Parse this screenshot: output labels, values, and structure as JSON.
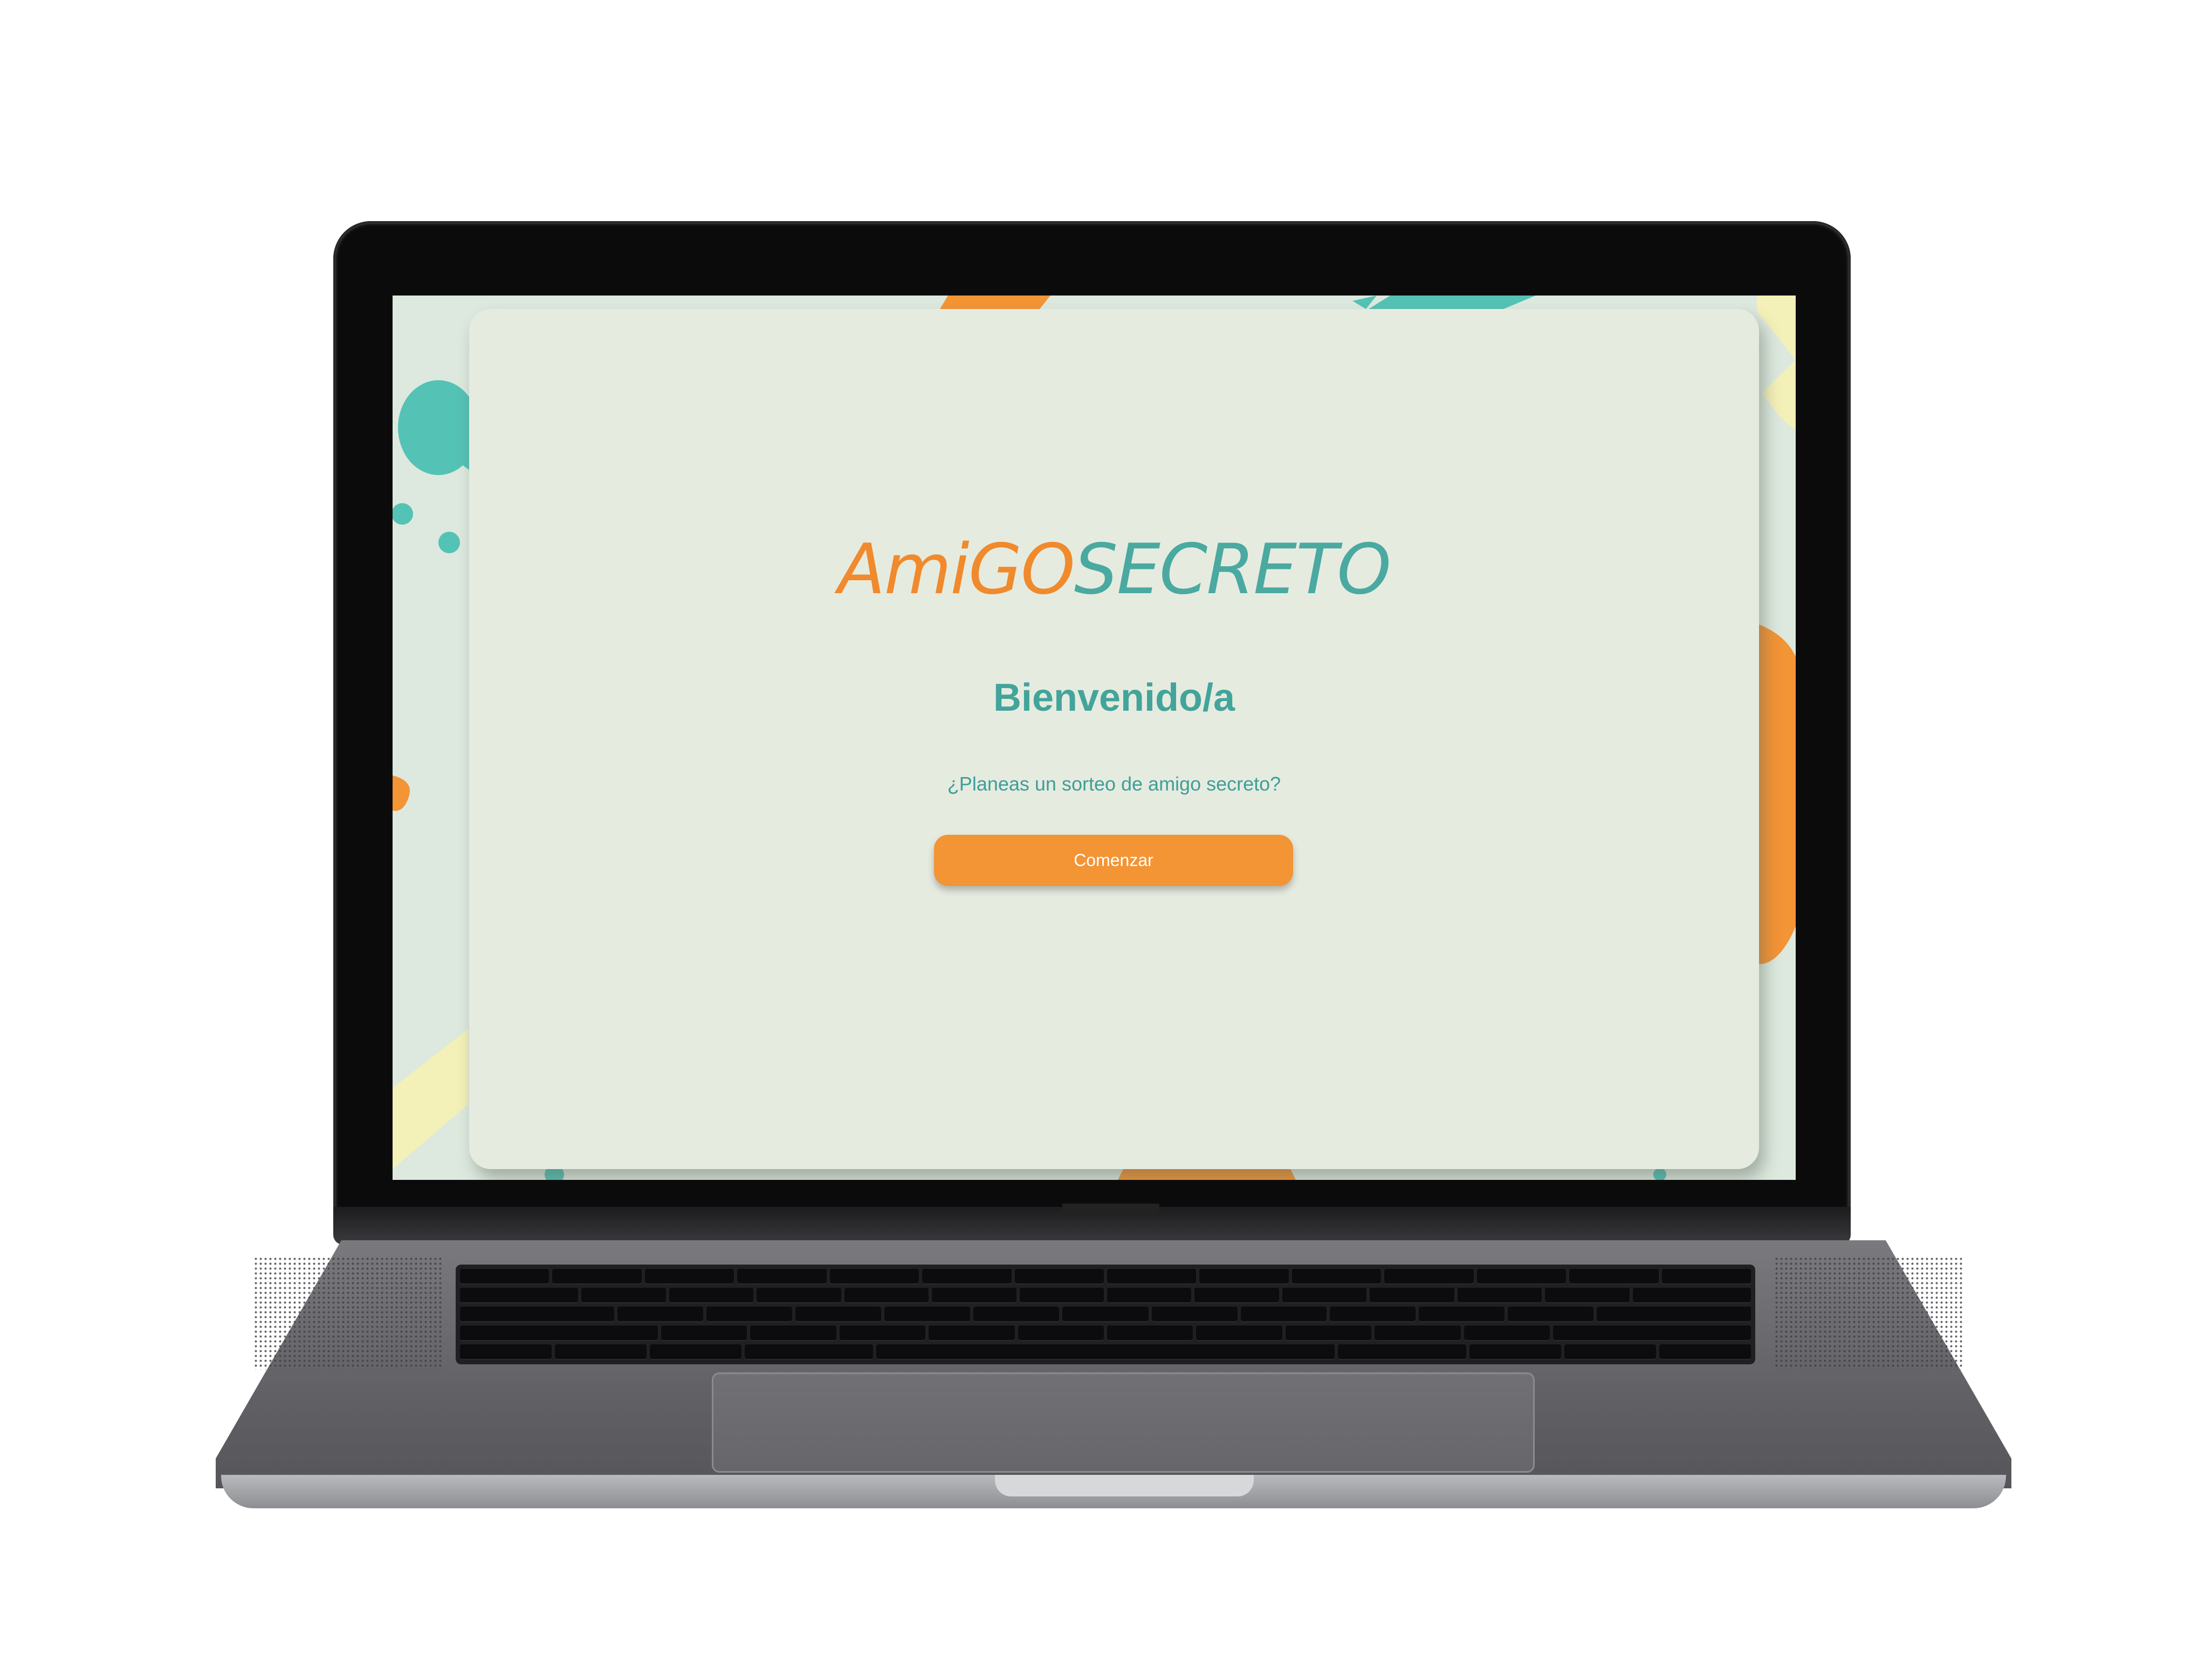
{
  "app": {
    "logo_part1": "AmiGO",
    "logo_part2": "SECRETO",
    "welcome_title": "Bienvenido/a",
    "question": "¿Planeas un sorteo de amigo secreto?",
    "start_button_label": "Comenzar"
  },
  "colors": {
    "accent_orange": "#f39435",
    "accent_teal": "#42a49a",
    "card_background": "#e6ebe0",
    "screen_background": "#dde9de",
    "blob_yellow": "#f3f0b8"
  },
  "device": {
    "type": "laptop"
  }
}
